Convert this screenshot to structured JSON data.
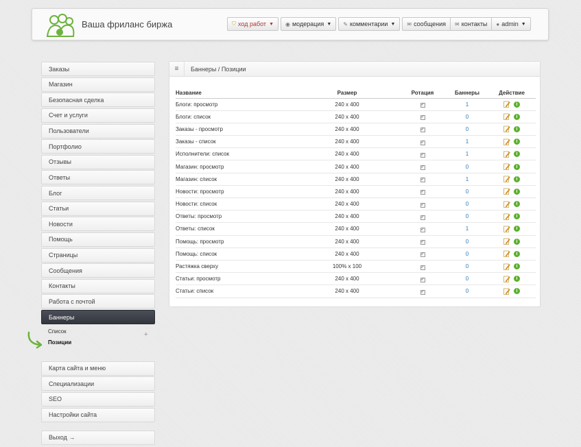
{
  "header": {
    "brand": "Ваша фриланс биржа",
    "nav": [
      {
        "label": "ход работ",
        "icon": "shield-icon",
        "dropdown": true,
        "active": true
      },
      {
        "label": "модерация",
        "icon": "eye-icon",
        "dropdown": true
      },
      {
        "label": "комментарии",
        "icon": "pencil-icon",
        "dropdown": true
      },
      {
        "label": "сообщения",
        "icon": "envelope-icon",
        "dropdown": false
      },
      {
        "label": "контакты",
        "icon": "envelope-icon",
        "dropdown": false
      },
      {
        "label": "admin",
        "icon": "user-icon",
        "dropdown": true
      }
    ]
  },
  "sidebar": {
    "items": [
      "Заказы",
      "Магазин",
      "Безопасная сделка",
      "Счет и услуги",
      "Пользователи",
      "Портфолио",
      "Отзывы",
      "Ответы",
      "Блог",
      "Статьи",
      "Новости",
      "Помощь",
      "Страницы",
      "Сообщения",
      "Контакты",
      "Работа с почтой"
    ],
    "active_item": "Баннеры",
    "sub_items": [
      "Список",
      "Позиции"
    ],
    "items_after": [
      "Карта сайта и меню",
      "Специализации",
      "SEO",
      "Настройки сайта"
    ],
    "logout": "Выход →"
  },
  "panel": {
    "title": "Баннеры / Позиции",
    "columns": [
      "Название",
      "Размер",
      "Ротация",
      "Баннеры",
      "Действие"
    ],
    "rows": [
      {
        "name": "Блоги: просмотр",
        "size": "240 x 400",
        "banners": "1"
      },
      {
        "name": "Блоги: список",
        "size": "240 x 400",
        "banners": "0"
      },
      {
        "name": "Заказы - просмотр",
        "size": "240 x 400",
        "banners": "0"
      },
      {
        "name": "Заказы - список",
        "size": "240 x 400",
        "banners": "1"
      },
      {
        "name": "Исполнители: список",
        "size": "240 x 400",
        "banners": "1"
      },
      {
        "name": "Магазин: просмотр",
        "size": "240 x 400",
        "banners": "0"
      },
      {
        "name": "Магазин: список",
        "size": "240 x 400",
        "banners": "1"
      },
      {
        "name": "Новости: просмотр",
        "size": "240 x 400",
        "banners": "0"
      },
      {
        "name": "Новости: список",
        "size": "240 x 400",
        "banners": "0"
      },
      {
        "name": "Ответы: просмотр",
        "size": "240 x 400",
        "banners": "0"
      },
      {
        "name": "Ответы: список",
        "size": "240 x 400",
        "banners": "1"
      },
      {
        "name": "Помощь: просмотр",
        "size": "240 x 400",
        "banners": "0"
      },
      {
        "name": "Помощь: список",
        "size": "240 x 400",
        "banners": "0"
      },
      {
        "name": "Растяжка сверху",
        "size": "100% x 100",
        "banners": "0"
      },
      {
        "name": "Статьи: просмотр",
        "size": "240 x 400",
        "banners": "0"
      },
      {
        "name": "Статьи: список",
        "size": "240 x 400",
        "banners": "0"
      }
    ]
  },
  "colors": {
    "accent_green": "#5bb02d",
    "link_blue": "#2a7ac0",
    "active_dark": "#3a3d44"
  }
}
